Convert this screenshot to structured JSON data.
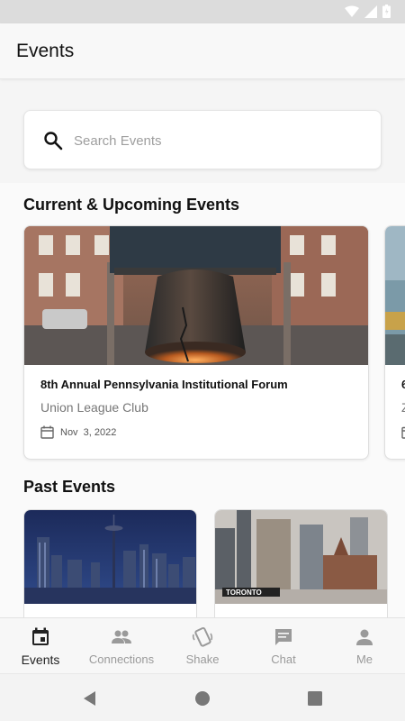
{
  "app": {
    "title": "Events"
  },
  "search": {
    "placeholder": "Search Events"
  },
  "sections": {
    "current": "Current & Upcoming Events",
    "past": "Past Events"
  },
  "current_events": [
    {
      "title": "8th Annual Pennsylvania Institutional Forum",
      "venue": "Union League Club",
      "date": "Nov  3, 2022"
    },
    {
      "title": "6",
      "venue": "Z",
      "date": ""
    }
  ],
  "past_events": [
    {
      "image": "seattle-skyline-image"
    },
    {
      "image": "toronto-city-image",
      "sign": "TORONTO"
    }
  ],
  "bottom_nav": [
    {
      "label": "Events",
      "icon": "calendar-icon",
      "active": true
    },
    {
      "label": "Connections",
      "icon": "people-icon",
      "active": false
    },
    {
      "label": "Shake",
      "icon": "shake-phone-icon",
      "active": false
    },
    {
      "label": "Chat",
      "icon": "chat-bubble-icon",
      "active": false
    },
    {
      "label": "Me",
      "icon": "person-icon",
      "active": false
    }
  ],
  "colors": {
    "active": "#222222",
    "inactive": "#9a9a9a",
    "placeholder": "#9e9e9e"
  }
}
